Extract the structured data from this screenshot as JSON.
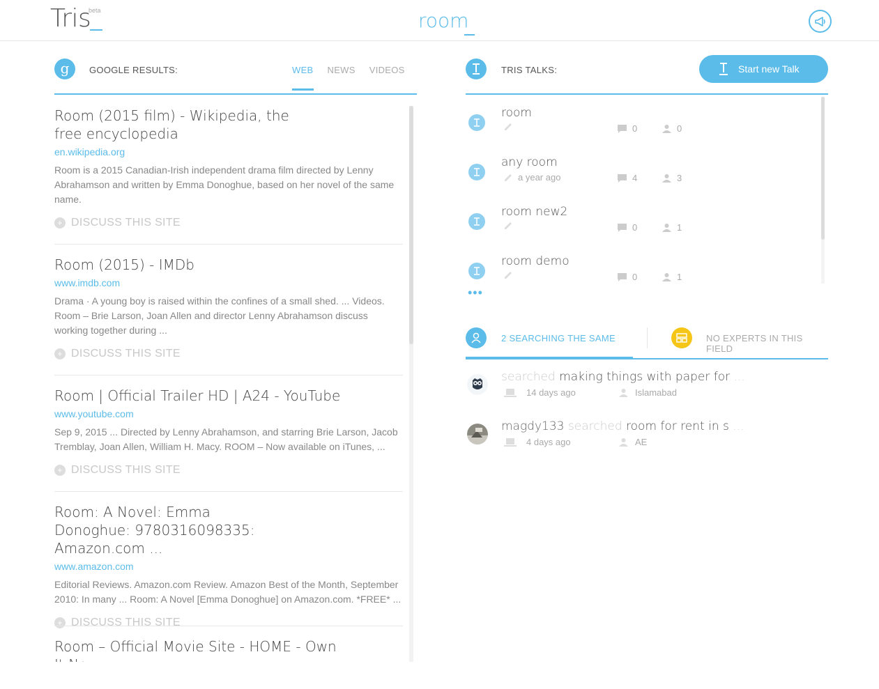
{
  "header": {
    "logo": "Tris",
    "beta": "beta",
    "search_term": "room"
  },
  "google": {
    "title": "GOOGLE RESULTS:",
    "icon_letter": "g",
    "tabs": [
      {
        "label": "WEB",
        "active": true
      },
      {
        "label": "NEWS",
        "active": false
      },
      {
        "label": "VIDEOS",
        "active": false
      }
    ],
    "discuss_label": "DISCUSS THIS SITE",
    "results": [
      {
        "title": "Room (2015 film) - Wikipedia, the free encyclopedia",
        "url": "en.wikipedia.org",
        "desc": "Room is a 2015 Canadian-Irish independent drama film directed by Lenny Abrahamson and written by Emma Donoghue, based on her novel of the same name."
      },
      {
        "title": "Room (2015) - IMDb",
        "url": "www.imdb.com",
        "desc": "Drama · A young boy is raised within the confines of a small shed. ... Videos. Room – Brie Larson, Joan Allen and director Lenny Abrahamson discuss working together during ..."
      },
      {
        "title": "Room | Official Trailer HD | A24 - YouTube",
        "url": "www.youtube.com",
        "desc": "Sep 9, 2015 ... Directed by Lenny Abrahamson, and starring Brie Larson, Jacob Tremblay, Joan Allen, William H. Macy. ROOM – Now available on iTunes, ..."
      },
      {
        "title": "Room: A Novel: Emma Donoghue: 9780316098335: Amazon.com ...",
        "url": "www.amazon.com",
        "desc": "Editorial Reviews. Amazon.com Review. Amazon Best of the Month, September 2010: In many ... Room: A Novel [Emma Donoghue] on Amazon.com. *FREE* ..."
      },
      {
        "title": "Room – Official Movie Site - HOME - Own It Now"
      }
    ]
  },
  "talks": {
    "title": "TRIS TALKS:",
    "new_talk_label": "Start new Talk",
    "more": "•••",
    "items": [
      {
        "name": "room",
        "time": "",
        "comments": "0",
        "users": "0"
      },
      {
        "name": "any room",
        "time": "a year ago",
        "comments": "4",
        "users": "3"
      },
      {
        "name": "room new2",
        "time": "",
        "comments": "0",
        "users": "1"
      },
      {
        "name": "room demo",
        "time": "",
        "comments": "0",
        "users": "1"
      }
    ]
  },
  "searching": {
    "tab_same": "2 SEARCHING THE SAME",
    "tab_experts": "NO EXPERTS IN THIS FIELD",
    "items": [
      {
        "user": "",
        "verb": "searched",
        "query": "making things with paper for",
        "ellipsis": "...",
        "time": "14 days ago",
        "location": "Islamabad"
      },
      {
        "user": "magdy133",
        "verb": "searched",
        "query": "room for rent in s",
        "ellipsis": "...",
        "time": "4 days ago",
        "location": "AE"
      }
    ]
  },
  "colors": {
    "accent": "#5bbcea",
    "experts": "#f5c518"
  }
}
